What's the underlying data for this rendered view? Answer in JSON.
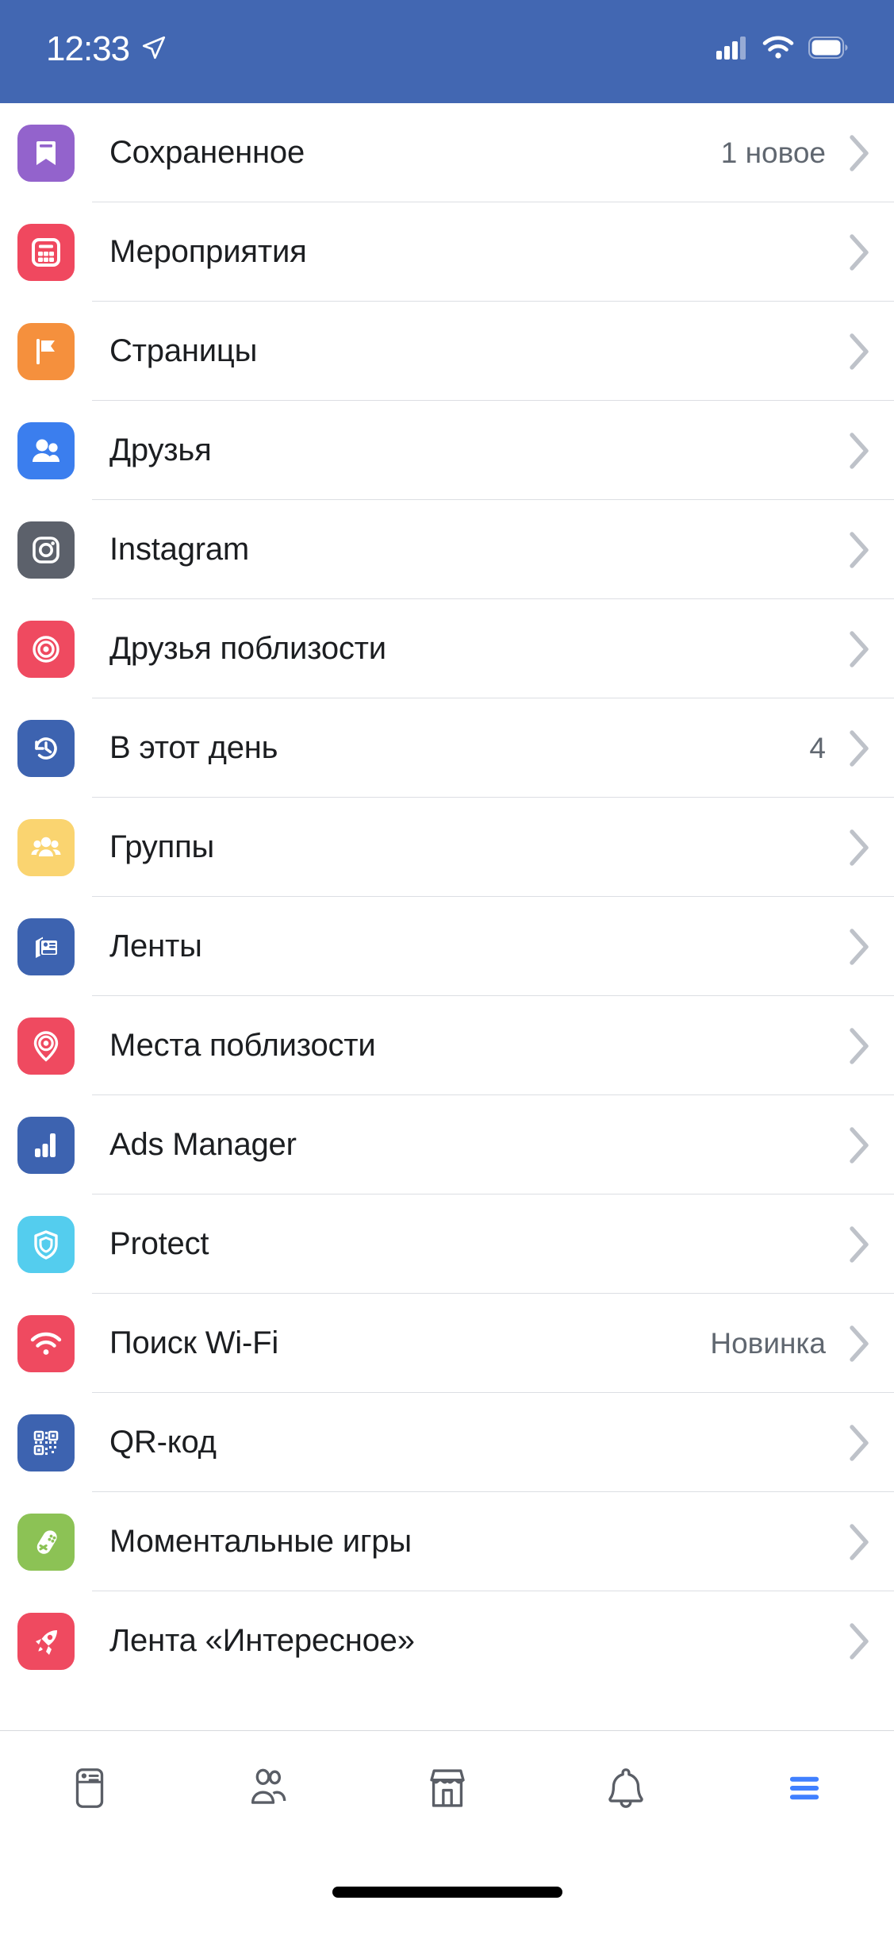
{
  "status_bar": {
    "time": "12:33",
    "location_icon": "location-arrow-icon",
    "signal_icon": "cellular-signal-icon",
    "wifi_icon": "wifi-icon",
    "battery_icon": "battery-full-icon",
    "background_color": "#4267b2"
  },
  "menu": {
    "items": [
      {
        "label": "Сохраненное",
        "badge": "1 новое",
        "icon": "bookmark-icon",
        "icon_bg": "#9363cc"
      },
      {
        "label": "Мероприятия",
        "badge": "",
        "icon": "calendar-icon",
        "icon_bg": "#f0485f"
      },
      {
        "label": "Страницы",
        "badge": "",
        "icon": "flag-icon",
        "icon_bg": "#f5903d"
      },
      {
        "label": "Друзья",
        "badge": "",
        "icon": "friends-icon",
        "icon_bg": "#3b7eee"
      },
      {
        "label": "Instagram",
        "badge": "",
        "icon": "instagram-icon",
        "icon_bg": "#5c616b"
      },
      {
        "label": "Друзья поблизости",
        "badge": "",
        "icon": "target-icon",
        "icon_bg": "#ef4a60"
      },
      {
        "label": "В этот день",
        "badge": "4",
        "icon": "history-clock-icon",
        "icon_bg": "#3d63b0"
      },
      {
        "label": "Группы",
        "badge": "",
        "icon": "groups-icon",
        "icon_bg": "#fad470"
      },
      {
        "label": "Ленты",
        "badge": "",
        "icon": "feeds-icon",
        "icon_bg": "#3d63b0"
      },
      {
        "label": "Места поблизости",
        "badge": "",
        "icon": "map-pin-icon",
        "icon_bg": "#ef4a60"
      },
      {
        "label": "Ads Manager",
        "badge": "",
        "icon": "bar-chart-icon",
        "icon_bg": "#3d63b0"
      },
      {
        "label": "Protect",
        "badge": "",
        "icon": "shield-icon",
        "icon_bg": "#54cdee"
      },
      {
        "label": "Поиск Wi-Fi",
        "badge": "Новинка",
        "icon": "wifi-find-icon",
        "icon_bg": "#ef4a60"
      },
      {
        "label": "QR-код",
        "badge": "",
        "icon": "qr-code-icon",
        "icon_bg": "#3d63b0"
      },
      {
        "label": "Моментальные игры",
        "badge": "",
        "icon": "gamepad-icon",
        "icon_bg": "#8cc255"
      },
      {
        "label": "Лента «Интересное»",
        "badge": "",
        "icon": "rocket-icon",
        "icon_bg": "#ef4a60"
      }
    ],
    "chevron_icon": "chevron-right-icon",
    "chevron_color": "#bec2c9",
    "label_color": "#1c1e21",
    "badge_color": "#606770"
  },
  "tab_bar": {
    "tabs": [
      {
        "name": "news-feed",
        "icon": "news-feed-icon",
        "active": false
      },
      {
        "name": "friends",
        "icon": "friends-tab-icon",
        "active": false
      },
      {
        "name": "marketplace",
        "icon": "marketplace-icon",
        "active": false
      },
      {
        "name": "notifications",
        "icon": "bell-icon",
        "active": false
      },
      {
        "name": "menu",
        "icon": "hamburger-menu-icon",
        "active": true
      }
    ],
    "inactive_color": "#5a5e66",
    "active_color": "#4080ff"
  },
  "home_indicator": {
    "color": "#000000"
  }
}
